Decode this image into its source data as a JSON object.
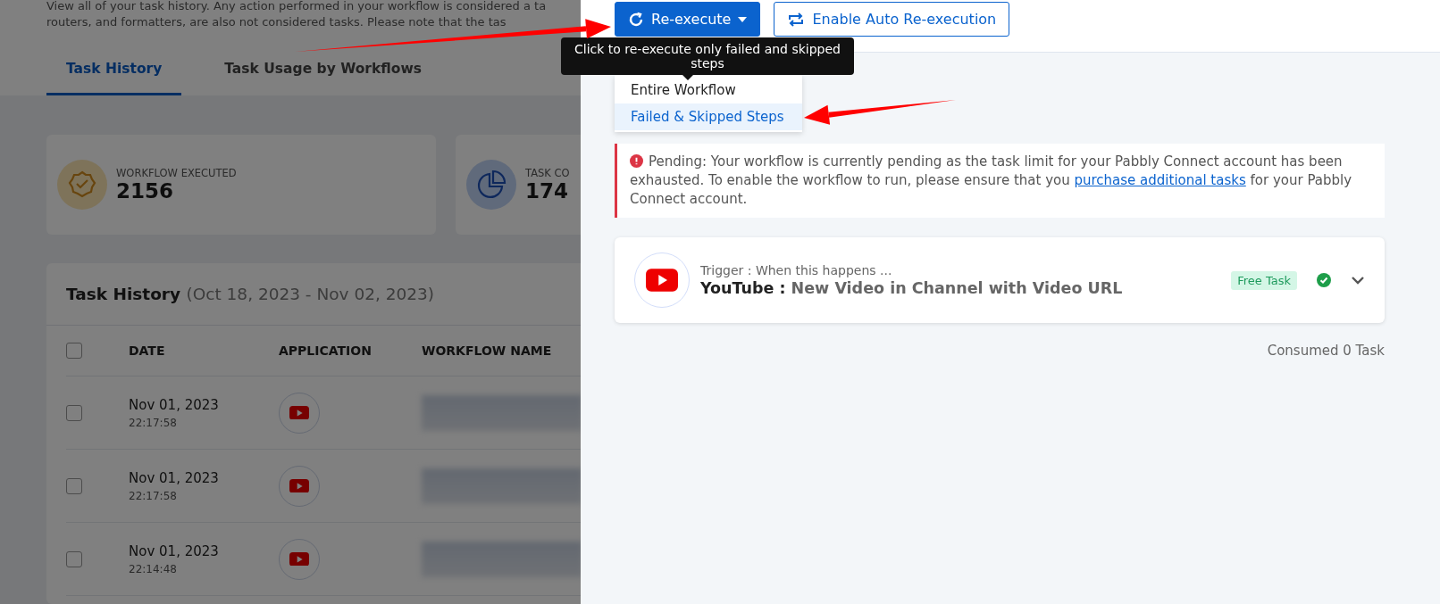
{
  "intro": [
    "View all of your task history. Any action performed in your workflow is considered a ta",
    "routers, and formatters, are also not considered tasks. Please note that the tas"
  ],
  "tabs": [
    {
      "label": "Task History",
      "selected": true
    },
    {
      "label": "Task Usage by Workflows",
      "selected": false
    }
  ],
  "stats": [
    {
      "kind": "badge",
      "label": "WORKFLOW EXECUTED",
      "value": "2156"
    },
    {
      "kind": "pie",
      "label": "TASK CO",
      "value": "174"
    }
  ],
  "task_history": {
    "title": "Task History",
    "range": "(Oct 18, 2023 - Nov 02, 2023)",
    "header_checked": false,
    "columns": [
      "DATE",
      "APPLICATION",
      "WORKFLOW NAME"
    ],
    "rows": [
      {
        "date": "Nov 01, 2023",
        "time": "22:17:58",
        "checked": false
      },
      {
        "date": "Nov 01, 2023",
        "time": "22:17:58",
        "checked": false
      },
      {
        "date": "Nov 01, 2023",
        "time": "22:14:48",
        "checked": false
      }
    ]
  },
  "drawer": {
    "buttons": [
      {
        "kind": "primary",
        "label": "Re-execute"
      },
      {
        "kind": "outline",
        "label": "Enable Auto Re-execution"
      }
    ],
    "tooltip": "Click to re-execute only failed and skipped steps",
    "menu": [
      {
        "label": "Entire Workflow",
        "selected": false
      },
      {
        "label": "Failed & Skipped Steps",
        "selected": true
      }
    ],
    "alert": {
      "before": "Pending: Your workflow is currently pending as the task limit for your Pabbly Connect account has been exhausted. To enable the workflow to run, please ensure that you",
      "link": "purchase additional tasks",
      "after": "for your Pabbly Connect account."
    },
    "trigger": {
      "caption": "Trigger : When this happens ...",
      "app": "YouTube :",
      "event": "New Video in Channel with Video URL",
      "badge": "Free Task",
      "success": true
    },
    "consumed": "Consumed 0 Task"
  }
}
